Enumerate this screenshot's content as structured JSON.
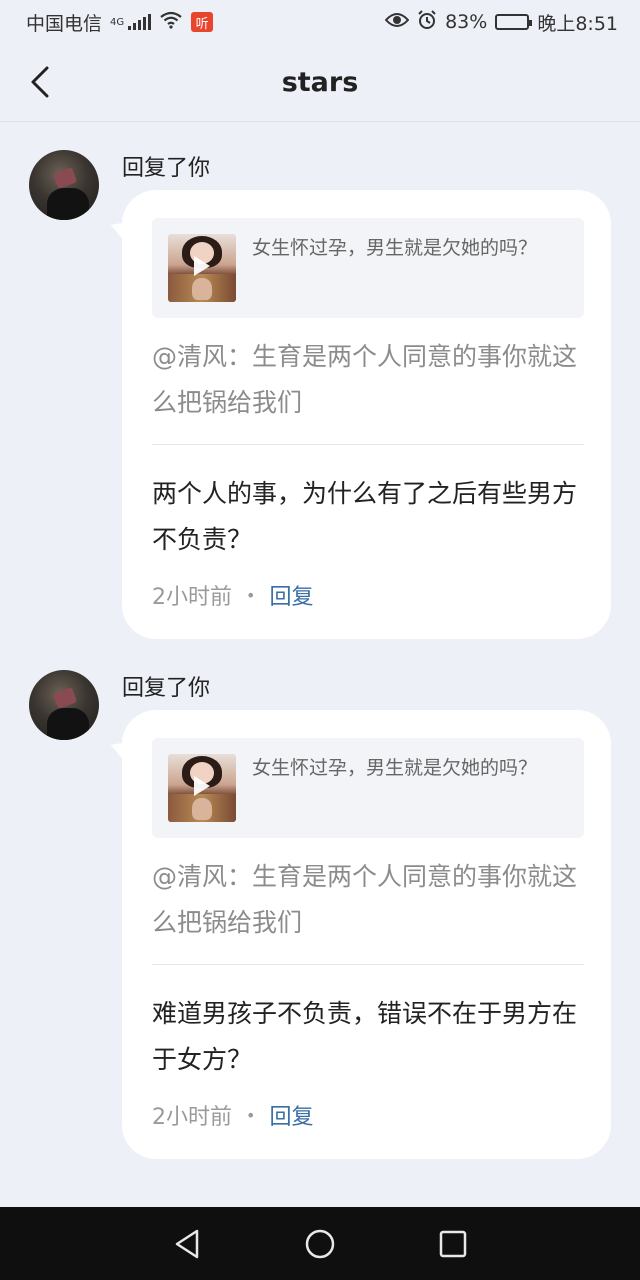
{
  "status_bar": {
    "carrier": "中国电信",
    "network": "4G",
    "app_badge": "听",
    "battery_percent": "83%",
    "battery_level": 0.83,
    "time": "晚上8:51"
  },
  "header": {
    "title": "stars",
    "back_icon": "chevron-left-icon"
  },
  "notifications": [
    {
      "reply_label": "回复了你",
      "video_title": "女生怀过孕，男生就是欠她的吗？",
      "quote": "@清风：生育是两个人同意的事你就这么把锅给我们",
      "reply": "两个人的事，为什么有了之后有些男方不负责？",
      "time_ago": "2小时前",
      "separator": "•",
      "reply_action": "回复"
    },
    {
      "reply_label": "回复了你",
      "video_title": "女生怀过孕，男生就是欠她的吗？",
      "quote": "@清风：生育是两个人同意的事你就这么把锅给我们",
      "reply": "难道男孩子不负责，错误不在于男方在于女方？",
      "time_ago": "2小时前",
      "separator": "•",
      "reply_action": "回复"
    }
  ],
  "nav_bar": {
    "back_icon": "triangle-back-icon",
    "home_icon": "circle-home-icon",
    "recents_icon": "square-recents-icon"
  },
  "colors": {
    "background": "#eef0f7",
    "bubble": "#ffffff",
    "link": "#3a6ea5",
    "nav_bar": "#0f0f10"
  }
}
